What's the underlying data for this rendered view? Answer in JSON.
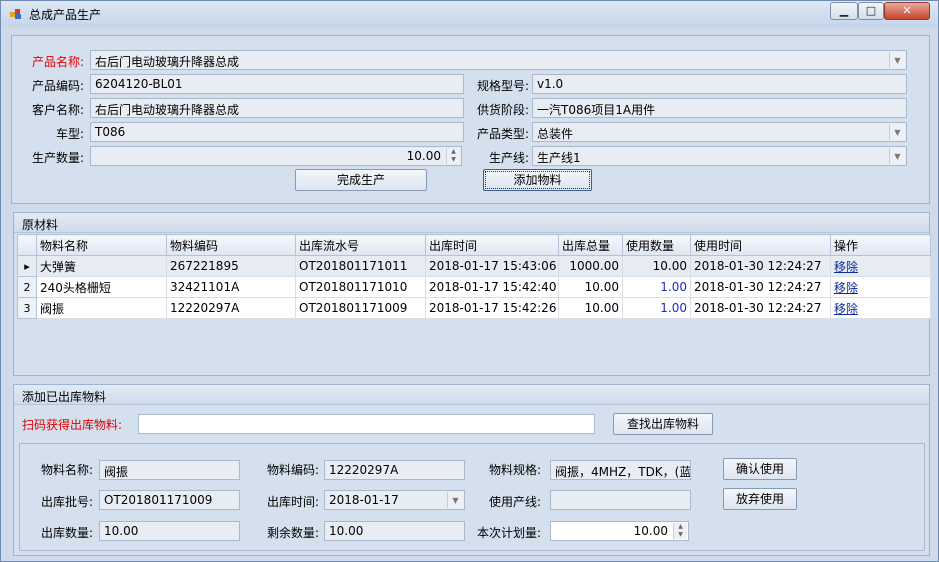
{
  "window": {
    "title": "总成产品生产"
  },
  "product": {
    "name_label": "产品名称:",
    "name": "右后门电动玻璃升降器总成",
    "code_label": "产品编码:",
    "code": "6204120-BL01",
    "spec_label": "规格型号:",
    "spec": "v1.0",
    "customer_label": "客户名称:",
    "customer": "右后门电动玻璃升降器总成",
    "supply_label": "供货阶段:",
    "supply": "一汽T086项目1A用件",
    "model_label": "车型:",
    "model": "T086",
    "type_label": "产品类型:",
    "type": "总装件",
    "qty_label": "生产数量:",
    "qty": "10.00",
    "line_label": "生产线:",
    "line": "生产线1",
    "complete_button": "完成生产",
    "add_material_button": "添加物料"
  },
  "materials": {
    "title": "原材料",
    "columns": [
      "物料名称",
      "物料编码",
      "出库流水号",
      "出库时间",
      "出库总量",
      "使用数量",
      "使用时间",
      "操作"
    ],
    "rows": [
      {
        "marker": "▸",
        "name": "大弹簧",
        "code": "267221895",
        "serial": "OT201801171011",
        "out_time": "2018-01-17 15:43:06",
        "total": "1000.00",
        "used": "10.00",
        "use_time": "2018-01-30 12:24:27",
        "action": "移除"
      },
      {
        "marker": "2",
        "name": "240头格栅短",
        "code": "32421101A",
        "serial": "OT201801171010",
        "out_time": "2018-01-17 15:42:40",
        "total": "10.00",
        "used": "1.00",
        "use_time": "2018-01-30 12:24:27",
        "action": "移除"
      },
      {
        "marker": "3",
        "name": "阀振",
        "code": "12220297A",
        "serial": "OT201801171009",
        "out_time": "2018-01-17 15:42:26",
        "total": "10.00",
        "used": "1.00",
        "use_time": "2018-01-30 12:24:27",
        "action": "移除"
      }
    ]
  },
  "add_section": {
    "title": "添加已出库物料",
    "scan_label": "扫码获得出库物料:",
    "scan_value": "",
    "find_button": "查找出库物料",
    "mat_name_label": "物料名称:",
    "mat_name": "阀振",
    "mat_code_label": "物料编码:",
    "mat_code": "12220297A",
    "mat_spec_label": "物料规格:",
    "mat_spec": "阀振，4MHZ，TDK，(蓝",
    "confirm_button": "确认使用",
    "batch_label": "出库批号:",
    "batch": "OT201801171009",
    "out_time_label": "出库时间:",
    "out_time": "2018-01-17",
    "use_line_label": "使用产线:",
    "use_line": "",
    "discard_button": "放弃使用",
    "out_qty_label": "出库数量:",
    "out_qty": "10.00",
    "remain_label": "剩余数量:",
    "remain": "10.00",
    "plan_label": "本次计划量:",
    "plan": "10.00"
  }
}
